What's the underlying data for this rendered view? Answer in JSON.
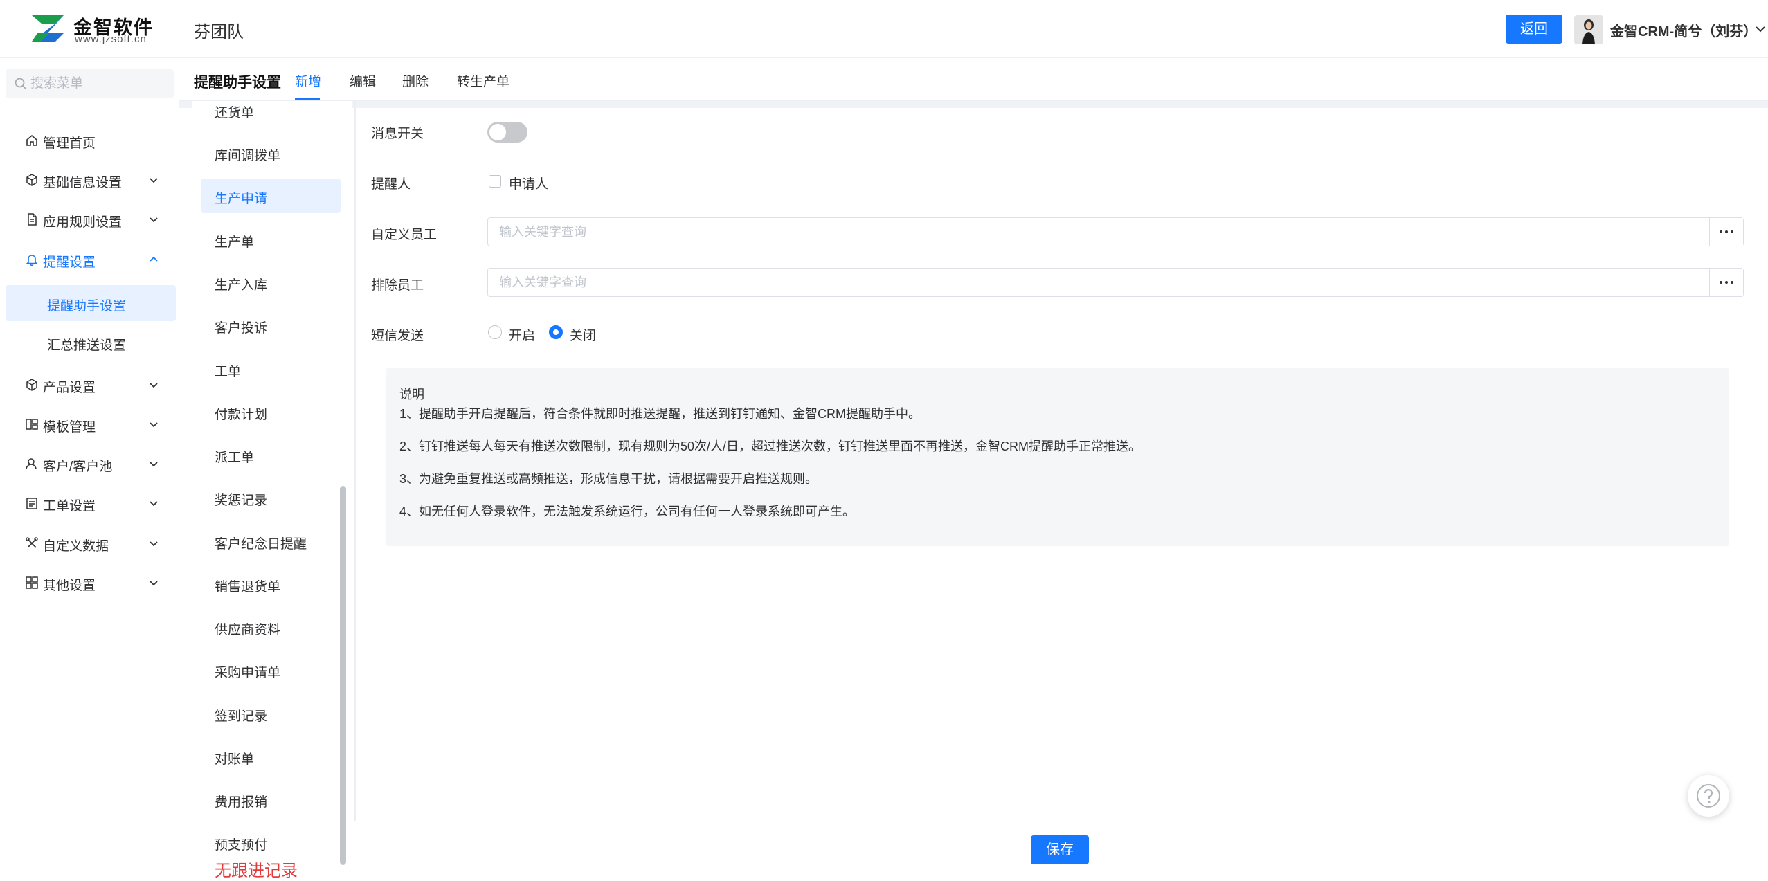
{
  "brand": {
    "name": "金智软件",
    "url": "www.jzsoft.cn",
    "accent": "#1677ff"
  },
  "header": {
    "company": "芬团队",
    "back_label": "返回",
    "user_name": "金智CRM-简兮（刘芬）"
  },
  "sidebar": {
    "search_placeholder": "搜索菜单",
    "items": [
      {
        "label": "管理首页",
        "icon": "home-icon"
      },
      {
        "label": "基础信息设置",
        "icon": "cube-icon"
      },
      {
        "label": "应用规则设置",
        "icon": "document-icon"
      },
      {
        "label": "提醒设置",
        "icon": "bell-icon",
        "expanded": true
      },
      {
        "label": "产品设置",
        "icon": "cube-icon"
      },
      {
        "label": "模板管理",
        "icon": "template-icon"
      },
      {
        "label": "客户/客户池",
        "icon": "user-icon"
      },
      {
        "label": "工单设置",
        "icon": "clipboard-icon"
      },
      {
        "label": "自定义数据",
        "icon": "tools-icon"
      },
      {
        "label": "其他设置",
        "icon": "grid-icon"
      }
    ],
    "sub_items": [
      {
        "label": "提醒助手设置",
        "selected": true
      },
      {
        "label": "汇总推送设置"
      }
    ]
  },
  "subheader": {
    "title": "提醒助手设置",
    "tabs": [
      "新增",
      "编辑",
      "删除",
      "转生产单"
    ],
    "active_tab": "新增"
  },
  "doc_types": {
    "partial_top": "还货单",
    "items": [
      "库间调拨单",
      "生产申请",
      "生产单",
      "生产入库",
      "客户投诉",
      "工单",
      "付款计划",
      "派工单",
      "奖惩记录",
      "客户纪念日提醒",
      "销售退货单",
      "供应商资料",
      "采购申请单",
      "签到记录",
      "对账单",
      "费用报销",
      "预支预付"
    ],
    "selected": "生产申请",
    "overflow_text": "无跟进记录"
  },
  "form": {
    "switch_label": "消息开关",
    "switch_on": false,
    "reminder_label": "提醒人",
    "applicant_option": "申请人",
    "applicant_checked": false,
    "custom_label": "自定义员工",
    "custom_placeholder": "输入关键字查询",
    "exclude_label": "排除员工",
    "exclude_placeholder": "输入关键字查询",
    "sms_label": "短信发送",
    "sms_on": "开启",
    "sms_off": "关闭",
    "sms_value": "关闭"
  },
  "notes": {
    "title": "说明",
    "lines": [
      "1、提醒助手开启提醒后，符合条件就即时推送提醒，推送到钉钉通知、金智CRM提醒助手中。",
      "2、钉钉推送每人每天有推送次数限制，现有规则为50次/人/日，超过推送次数，钉钉推送里面不再推送，金智CRM提醒助手正常推送。",
      "3、为避免重复推送或高频推送，形成信息干扰，请根据需要开启推送规则。",
      "4、如无任何人登录软件，无法触发系统运行，公司有任何一人登录系统即可产生。"
    ]
  },
  "footer": {
    "save_label": "保存"
  }
}
